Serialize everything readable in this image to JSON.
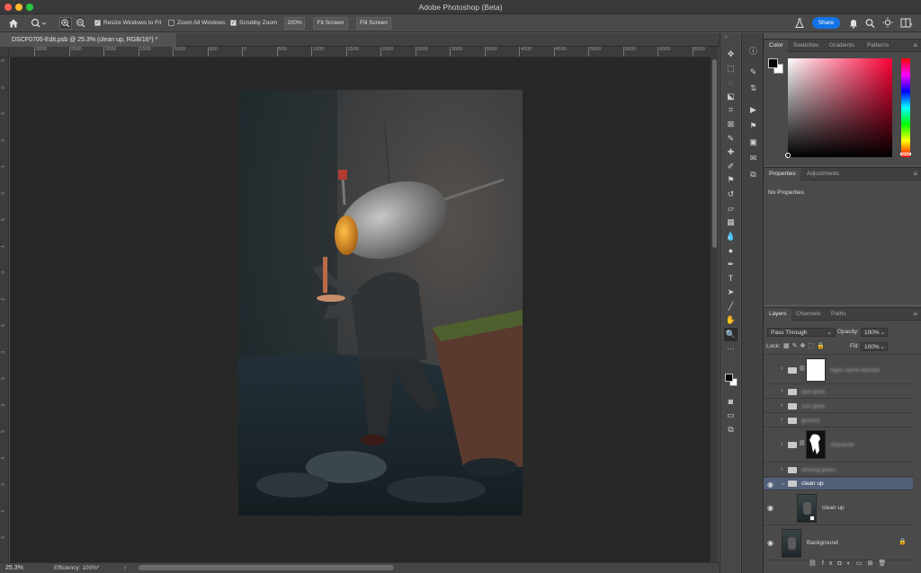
{
  "window": {
    "title": "Adobe Photoshop (Beta)"
  },
  "options_bar": {
    "resize_windows": {
      "label": "Resize Windows to Fit",
      "checked": true
    },
    "zoom_all": {
      "label": "Zoom All Windows",
      "checked": false
    },
    "scrubby": {
      "label": "Scrubby Zoom",
      "checked": true
    },
    "zoom_value": "100%",
    "fit_screen": "Fit Screen",
    "fill_screen": "Fill Screen",
    "share": "Share"
  },
  "document": {
    "tab_title": "DSCF0705-Edit.psb @ 25.3% (clean up, RGB/16*) *"
  },
  "ruler": {
    "top_ticks": [
      "3000",
      "2500",
      "2000",
      "1500",
      "1000",
      "500",
      "0",
      "500",
      "1000",
      "1500",
      "2000",
      "2500",
      "3000",
      "3500",
      "4000",
      "4500",
      "5000",
      "5500",
      "6000",
      "6500"
    ],
    "left_ticks": [
      "5",
      "0",
      "5",
      "0",
      "1",
      "0",
      "5",
      "1",
      "0",
      "2",
      "5",
      "3",
      "0",
      "3",
      "5",
      "4",
      "0",
      "4",
      "5"
    ]
  },
  "status": {
    "zoom": "25.3%",
    "efficiency": "Efficiency: 100%*"
  },
  "color_panel": {
    "tabs": [
      "Color",
      "Swatches",
      "Gradients",
      "Patterns"
    ],
    "active_tab": "Color",
    "hue_color": "#ff0036",
    "foreground": "#000000",
    "background": "#ffffff"
  },
  "properties_panel": {
    "tabs": [
      "Properties",
      "Adjustments"
    ],
    "active_tab": "Properties",
    "content": "No Properties"
  },
  "layers_panel": {
    "tabs": [
      "Layers",
      "Channels",
      "Paths"
    ],
    "active_tab": "Layers",
    "blend_mode": "Pass Through",
    "opacity_label": "Opacity:",
    "opacity": "100%",
    "lock_label": "Lock:",
    "fill_label": "Fill:",
    "fill": "100%",
    "layers": [
      {
        "name": "layer-name-blurred",
        "blurred": true
      },
      {
        "name": "eye-glow",
        "blurred": true
      },
      {
        "name": "sun-glow",
        "blurred": true
      },
      {
        "name": "ground",
        "blurred": true
      },
      {
        "name": "character",
        "blurred": true
      },
      {
        "name": "shining grass",
        "blurred": true
      },
      {
        "name": "clean up",
        "blurred": false
      },
      {
        "name": "clean up",
        "blurred": false
      },
      {
        "name": "Background",
        "blurred": false
      }
    ]
  }
}
